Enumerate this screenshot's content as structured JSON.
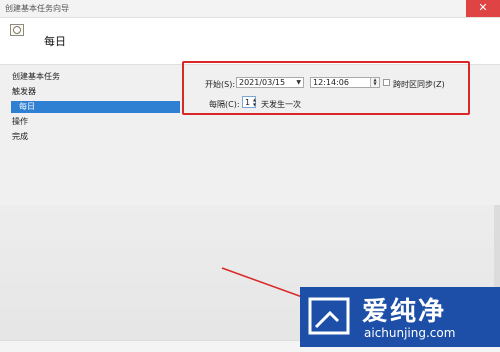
{
  "window": {
    "title": "创建基本任务向导",
    "close_glyph": "✕"
  },
  "header": {
    "title": "每日"
  },
  "sidebar": {
    "items": [
      {
        "label": "创建基本任务"
      },
      {
        "label": "触发器"
      },
      {
        "label": "每日"
      },
      {
        "label": "操作"
      },
      {
        "label": "完成"
      }
    ],
    "active_index": 2
  },
  "trigger": {
    "start_label": "开始(S):",
    "date_value": "2021/03/15",
    "time_value": "12:14:06",
    "sync_timezone_label": "跨时区同步(Z)",
    "sync_timezone_checked": false,
    "recur_label": "每隔(C):",
    "recur_value": "1",
    "recur_suffix": "天发生一次"
  },
  "watermark": {
    "text": "爱纯净",
    "url": "aichunjing.com"
  },
  "colors": {
    "accent": "#2f7fd3",
    "highlight": "#d82828",
    "watermark_bg": "#1d4fa8"
  }
}
